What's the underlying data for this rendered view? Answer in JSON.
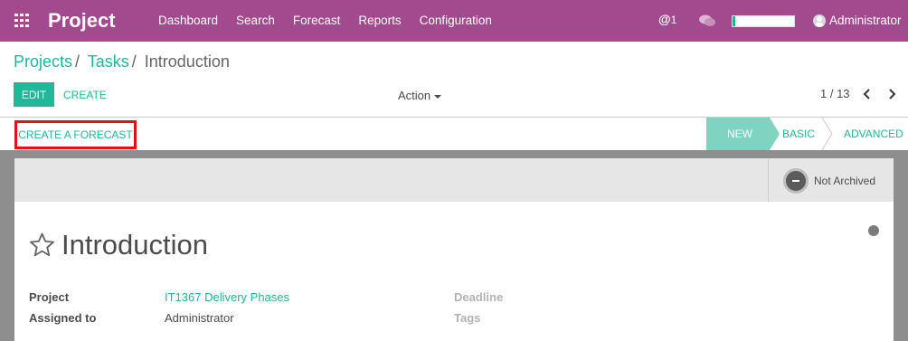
{
  "navbar": {
    "app_name": "Project",
    "menu": [
      {
        "label": "Dashboard"
      },
      {
        "label": "Search"
      },
      {
        "label": "Forecast"
      },
      {
        "label": "Reports"
      },
      {
        "label": "Configuration"
      }
    ],
    "mention_symbol": "@",
    "mention_count": "1",
    "progress_fraction": 0.05,
    "user_name": "Administrator",
    "bg_color": "#a24a8d"
  },
  "breadcrumb": {
    "items": [
      "Projects",
      "Tasks"
    ],
    "separator": "/",
    "current": "Introduction"
  },
  "controls": {
    "edit_label": "EDIT",
    "create_label": "CREATE",
    "action_label": "Action",
    "pager_value": "1 / 13"
  },
  "status_header": {
    "create_forecast_label": "CREATE A FORECAST",
    "stages": [
      {
        "label": "NEW",
        "active": true
      },
      {
        "label": "BASIC",
        "active": false
      },
      {
        "label": "ADVANCED",
        "active": false
      }
    ]
  },
  "form": {
    "archive_label": "Not Archived",
    "task_name": "Introduction",
    "fields": {
      "project_label": "Project",
      "project_value": "IT1367 Delivery Phases",
      "assigned_label": "Assigned to",
      "assigned_value": "Administrator",
      "deadline_label": "Deadline",
      "tags_label": "Tags"
    }
  },
  "colors": {
    "accent": "#21b799",
    "highlight_border": "#e3101c",
    "active_stage": "#7fd4c1"
  },
  "icons": [
    "apps-grid-icon",
    "at-icon",
    "chat-icon",
    "user-avatar-icon",
    "caret-down-icon",
    "chevron-left-icon",
    "chevron-right-icon",
    "archive-icon",
    "star-icon",
    "kanban-state-icon"
  ]
}
